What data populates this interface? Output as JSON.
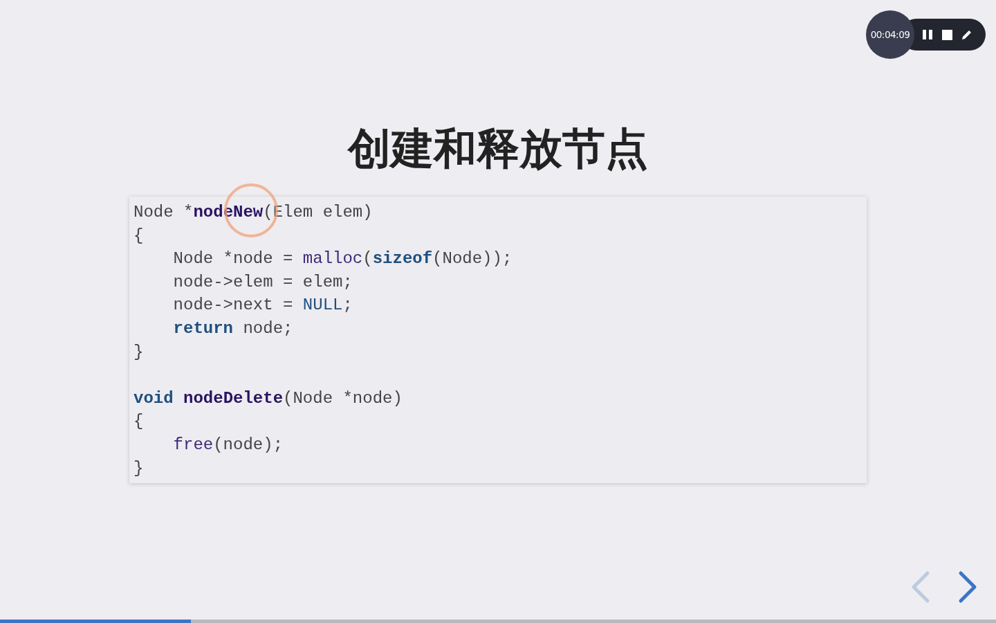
{
  "recorder": {
    "time": "00:04:09",
    "paused": false
  },
  "slide": {
    "title": "创建和释放节点",
    "code_blocks": [
      {
        "lines": [
          [
            {
              "text": "Node *",
              "kind": "plain"
            },
            {
              "text": "nodeNew",
              "kind": "function"
            },
            {
              "text": "(Elem elem)",
              "kind": "plain"
            }
          ],
          [
            {
              "text": "{",
              "kind": "plain"
            }
          ],
          [
            {
              "text": "    Node *node = ",
              "kind": "plain"
            },
            {
              "text": "malloc",
              "kind": "call"
            },
            {
              "text": "(",
              "kind": "plain"
            },
            {
              "text": "sizeof",
              "kind": "keyword"
            },
            {
              "text": "(Node));",
              "kind": "plain"
            }
          ],
          [
            {
              "text": "    node->elem = elem;",
              "kind": "plain"
            }
          ],
          [
            {
              "text": "    node->next = ",
              "kind": "plain"
            },
            {
              "text": "NULL",
              "kind": "constant"
            },
            {
              "text": ";",
              "kind": "plain"
            }
          ],
          [
            {
              "text": "    return",
              "kind": "keyword"
            },
            {
              "text": " node;",
              "kind": "plain"
            }
          ],
          [
            {
              "text": "}",
              "kind": "plain"
            }
          ]
        ]
      },
      {
        "lines": [
          [
            {
              "text": "void ",
              "kind": "keyword"
            },
            {
              "text": "nodeDelete",
              "kind": "function"
            },
            {
              "text": "(Node *node)",
              "kind": "plain"
            }
          ],
          [
            {
              "text": "{",
              "kind": "plain"
            }
          ],
          [
            {
              "text": "    free",
              "kind": "call"
            },
            {
              "text": "(node);",
              "kind": "plain"
            }
          ],
          [
            {
              "text": "}",
              "kind": "plain"
            }
          ]
        ]
      }
    ]
  },
  "navigation": {
    "previous_disabled": true,
    "next_disabled": false
  },
  "progress": {
    "level": 0.192
  }
}
